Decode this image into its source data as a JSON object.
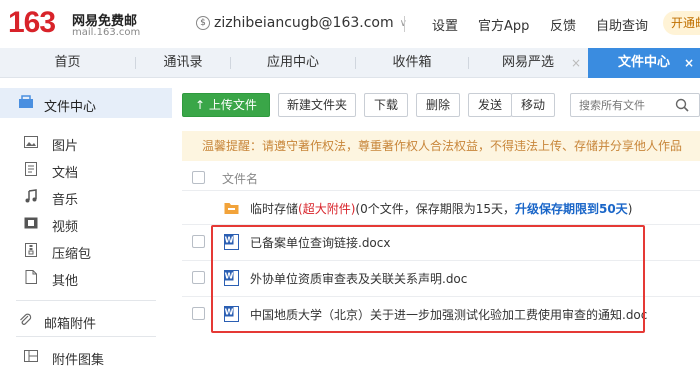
{
  "header": {
    "logo_number": "163",
    "logo_name": "网易免费邮",
    "logo_domain": "mail.163.com",
    "account": "zizhibeiancugb@163.com",
    "links": [
      "设置",
      "官方App",
      "反馈",
      "自助查询"
    ],
    "vip_label": "开通邮"
  },
  "tabs": [
    {
      "label": "首页"
    },
    {
      "label": "通讯录"
    },
    {
      "label": "应用中心"
    },
    {
      "label": "收件箱"
    },
    {
      "label": "网易严选",
      "close": "×"
    },
    {
      "label": "文件中心",
      "close": "×",
      "active": true
    }
  ],
  "sidebar": {
    "header": "文件中心",
    "items": [
      {
        "label": "图片",
        "icon": "image-icon"
      },
      {
        "label": "文档",
        "icon": "document-icon"
      },
      {
        "label": "音乐",
        "icon": "music-icon"
      },
      {
        "label": "视频",
        "icon": "video-icon"
      },
      {
        "label": "压缩包",
        "icon": "archive-icon"
      },
      {
        "label": "其他",
        "icon": "file-icon"
      }
    ],
    "attachments": "邮箱附件",
    "gallery": "附件图集"
  },
  "toolbar": {
    "upload": "上传文件",
    "new_folder": "新建文件夹",
    "download": "下载",
    "delete": "删除",
    "send": "发送",
    "move": "移动",
    "search_placeholder": "搜索所有文件"
  },
  "notice": "温馨提醒：请遵守著作权法，尊重著作权人合法权益，不得违法上传、存储并分享他人作品",
  "list": {
    "header": "文件名",
    "temp_storage": {
      "prefix": "临时存储",
      "highlight": "(超大附件)",
      "info": "(0个文件，保存期限为15天，",
      "upgrade": "升级保存期限到50天",
      "suffix": ")"
    },
    "files": [
      {
        "name": "已备案单位查询链接.docx"
      },
      {
        "name": "外协单位资质审查表及关联关系声明.doc"
      },
      {
        "name": "中国地质大学（北京）关于进一步加强测试化验加工费使用审查的通知.doc"
      }
    ]
  },
  "colors": {
    "brand_red": "#d8232a",
    "tab_active": "#3a8ce0",
    "upload_green": "#3aa648",
    "notice_bg": "#fdf5e0",
    "notice_text": "#c8863a",
    "highlight_border": "#e53935",
    "link_blue": "#1a66c8"
  }
}
